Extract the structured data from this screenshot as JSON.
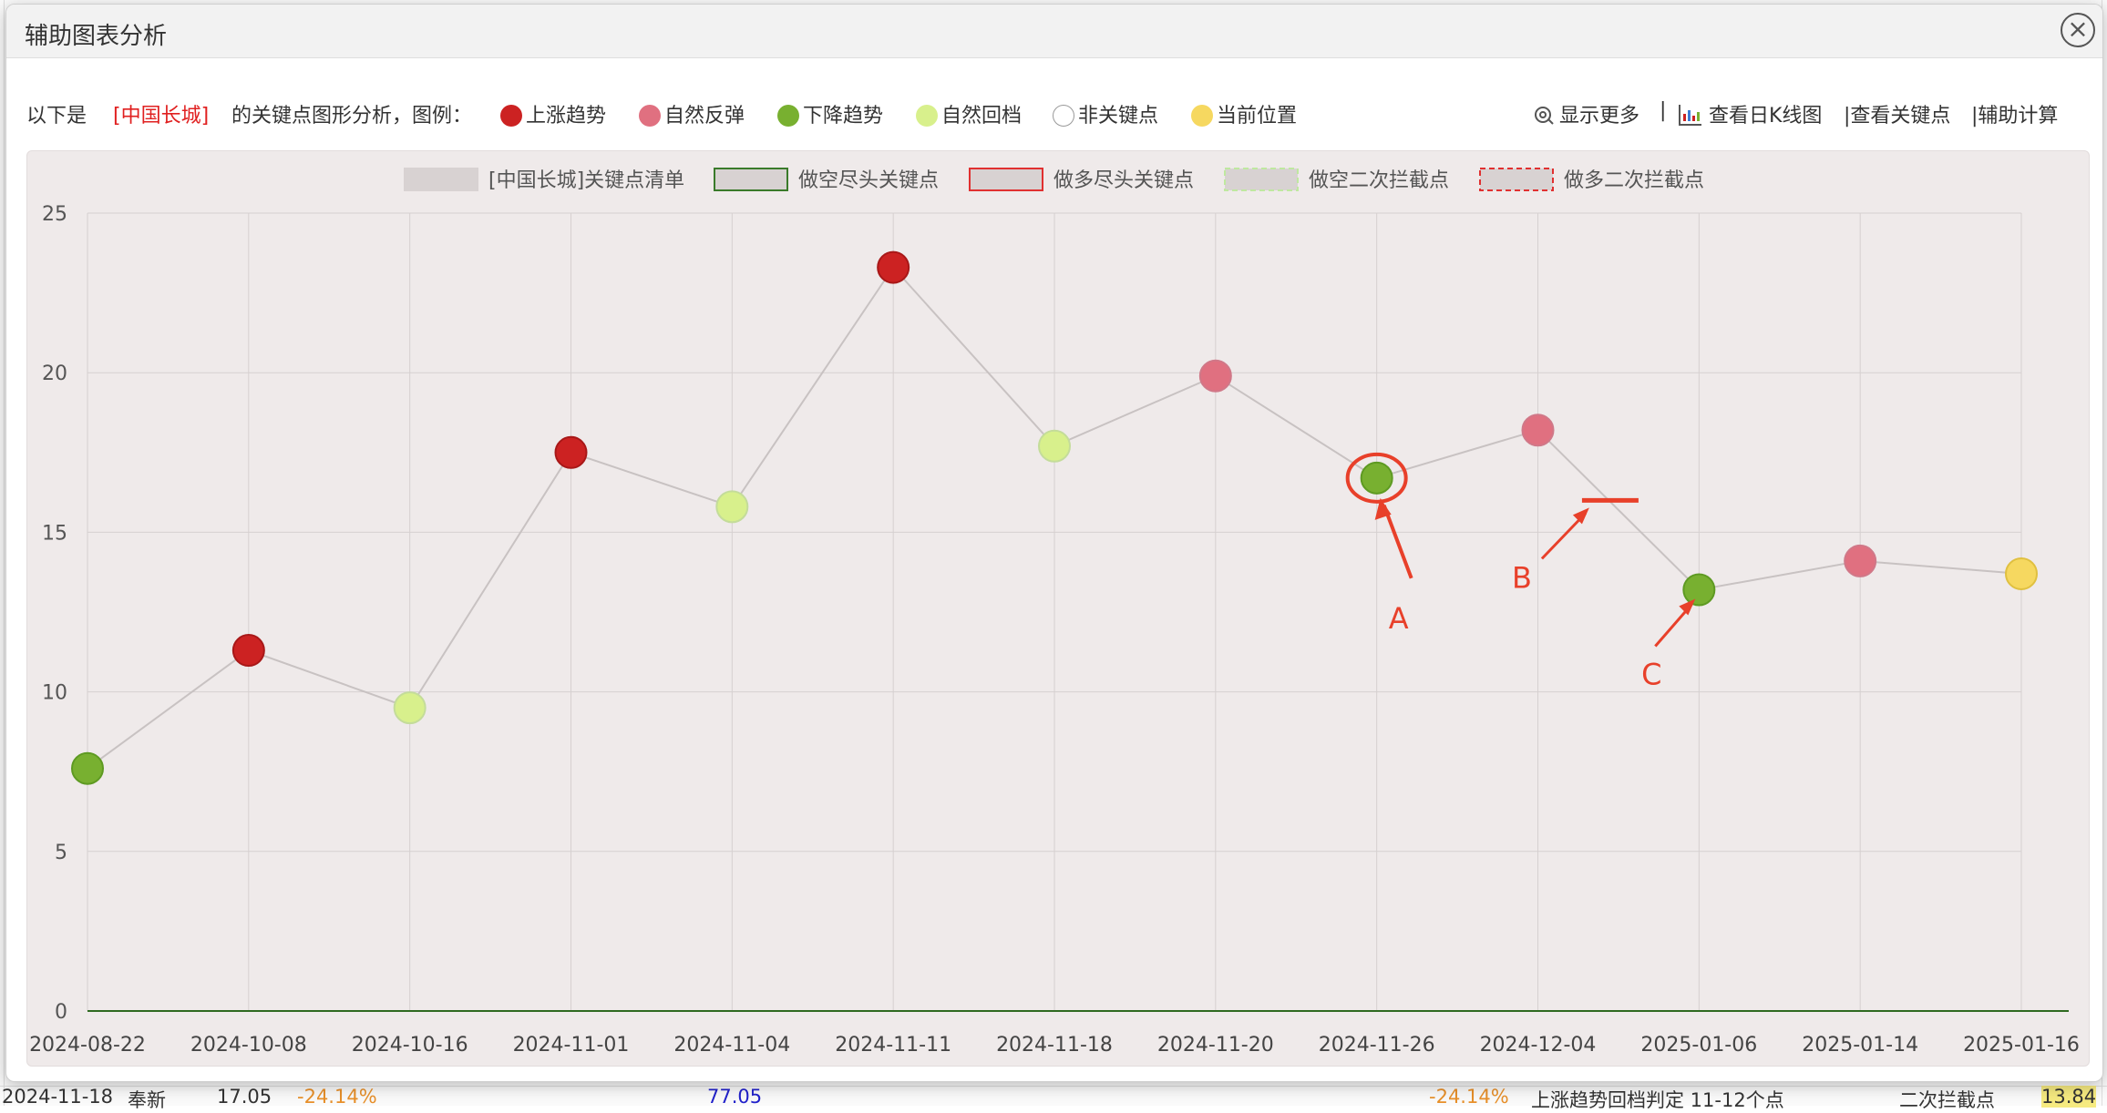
{
  "dialog": {
    "title": "辅助图表分析",
    "close_glyph": "×"
  },
  "info": {
    "prefix": "以下是",
    "stock_name": "[中国长城]",
    "suffix": "的关键点图形分析，图例：",
    "legend": [
      {
        "label": "上涨趋势",
        "color": "#cc2222"
      },
      {
        "label": "自然反弹",
        "color": "#e07080"
      },
      {
        "label": "下降趋势",
        "color": "#78b030"
      },
      {
        "label": "自然回档",
        "color": "#d8f08c"
      },
      {
        "label": "非关键点",
        "color": "#ffffff"
      },
      {
        "label": "当前位置",
        "color": "#f6d860"
      }
    ],
    "actions": {
      "show_more": "显示更多",
      "sep": "|",
      "view_kline": "查看日K线图",
      "view_keypoints": "|查看关键点",
      "aux_calc": "|辅助计算"
    }
  },
  "chart_data": {
    "type": "line",
    "legend": [
      "[中国长城]关键点清单",
      "做空尽头关键点",
      "做多尽头关键点",
      "做空二次拦截点",
      "做多二次拦截点"
    ],
    "categories": [
      "2024-08-22",
      "2024-10-08",
      "2024-10-16",
      "2024-11-01",
      "2024-11-04",
      "2024-11-11",
      "2024-11-18",
      "2024-11-20",
      "2024-11-26",
      "2024-12-04",
      "2025-01-06",
      "2025-01-14",
      "2025-01-16"
    ],
    "series": [
      {
        "name": "[中国长城]关键点清单",
        "values": [
          7.6,
          11.3,
          9.5,
          17.5,
          15.8,
          23.3,
          17.7,
          19.9,
          16.7,
          18.2,
          13.2,
          14.1,
          13.7
        ],
        "point_types": [
          "下降趋势",
          "上涨趋势",
          "自然回档",
          "上涨趋势",
          "自然回档",
          "上涨趋势",
          "自然回档",
          "自然反弹",
          "下降趋势",
          "自然反弹",
          "下降趋势",
          "自然反弹",
          "当前位置"
        ]
      },
      {
        "name": "做空尽头关键点",
        "values": [
          0,
          0,
          0,
          0,
          0,
          0,
          0,
          0,
          0,
          0,
          0,
          0,
          0
        ]
      }
    ],
    "ylim": [
      0,
      25
    ],
    "yticks": [
      0,
      5,
      10,
      15,
      20,
      25
    ],
    "grid": true,
    "legend_position": "top-center",
    "annotations": [
      {
        "label": "A",
        "target": "2024-11-26"
      },
      {
        "label": "B",
        "value": 16.0
      },
      {
        "label": "C",
        "target": "2025-01-06"
      }
    ],
    "annotation_color": "#e8402a"
  },
  "background": {
    "bottom_row": [
      "2024-11-18",
      "奉新",
      "17.05",
      "-24.14%",
      "77.05",
      "-24.14%",
      "上涨趋势回档判定 11-12个点",
      "二次拦截点",
      "13.84"
    ]
  }
}
